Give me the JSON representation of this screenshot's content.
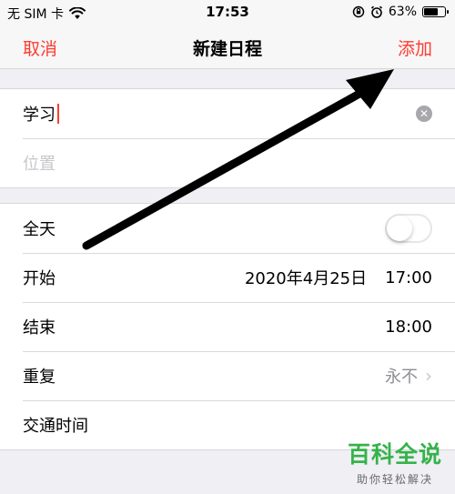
{
  "status_bar": {
    "carrier": "无 SIM 卡",
    "time": "17:53",
    "battery": "63%",
    "battery_level": 0.63,
    "icons": [
      "wifi-icon",
      "rotation-lock-icon",
      "alarm-icon",
      "battery-icon"
    ]
  },
  "nav": {
    "cancel": "取消",
    "title": "新建日程",
    "add": "添加",
    "accent": "#ff3b30"
  },
  "event": {
    "title_value": "学习",
    "location_placeholder": "位置"
  },
  "schedule": {
    "all_day_label": "全天",
    "all_day_on": false,
    "start_label": "开始",
    "start_date": "2020年4月25日",
    "start_time": "17:00",
    "end_label": "结束",
    "end_time": "18:00",
    "repeat_label": "重复",
    "repeat_value": "永不",
    "travel_label": "交通时间"
  },
  "watermark": {
    "title": "百科全说",
    "subtitle": "助你轻松解决",
    "color": "#35b34a"
  }
}
